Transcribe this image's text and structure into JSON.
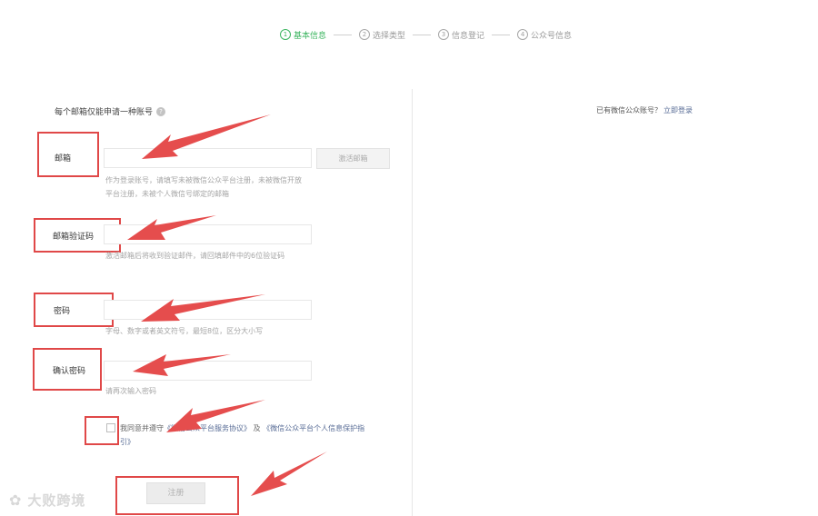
{
  "stepper": {
    "steps": [
      {
        "num": "1",
        "label": "基本信息"
      },
      {
        "num": "2",
        "label": "选择类型"
      },
      {
        "num": "3",
        "label": "信息登记"
      },
      {
        "num": "4",
        "label": "公众号信息"
      }
    ]
  },
  "form": {
    "intro": "每个邮箱仅能申请一种账号",
    "email": {
      "label": "邮箱",
      "value": "",
      "button": "激活邮箱",
      "hint": "作为登录账号，请填写未被微信公众平台注册，未被微信开放平台注册，未被个人微信号绑定的邮箱"
    },
    "code": {
      "label": "邮箱验证码",
      "value": "",
      "hint": "激活邮箱后将收到验证邮件，请回填邮件中的6位验证码"
    },
    "password": {
      "label": "密码",
      "value": "",
      "hint": "字母、数字或者英文符号，最短8位，区分大小写"
    },
    "confirm": {
      "label": "确认密码",
      "value": "",
      "hint": "请再次输入密码"
    },
    "agreement": {
      "prefix": "我同意并遵守",
      "link1": "《微信公众平台服务协议》",
      "middle": "及",
      "link2": "《微信公众平台个人信息保护指引》"
    },
    "register_button": "注册"
  },
  "side": {
    "question": "已有微信公众账号？",
    "login_link": "立即登录"
  },
  "watermark": {
    "icon": "✿",
    "text": "大败跨境"
  },
  "colors": {
    "accent_green": "#3bb45f",
    "annotation_red": "#e04848",
    "link_blue": "#576b95"
  }
}
